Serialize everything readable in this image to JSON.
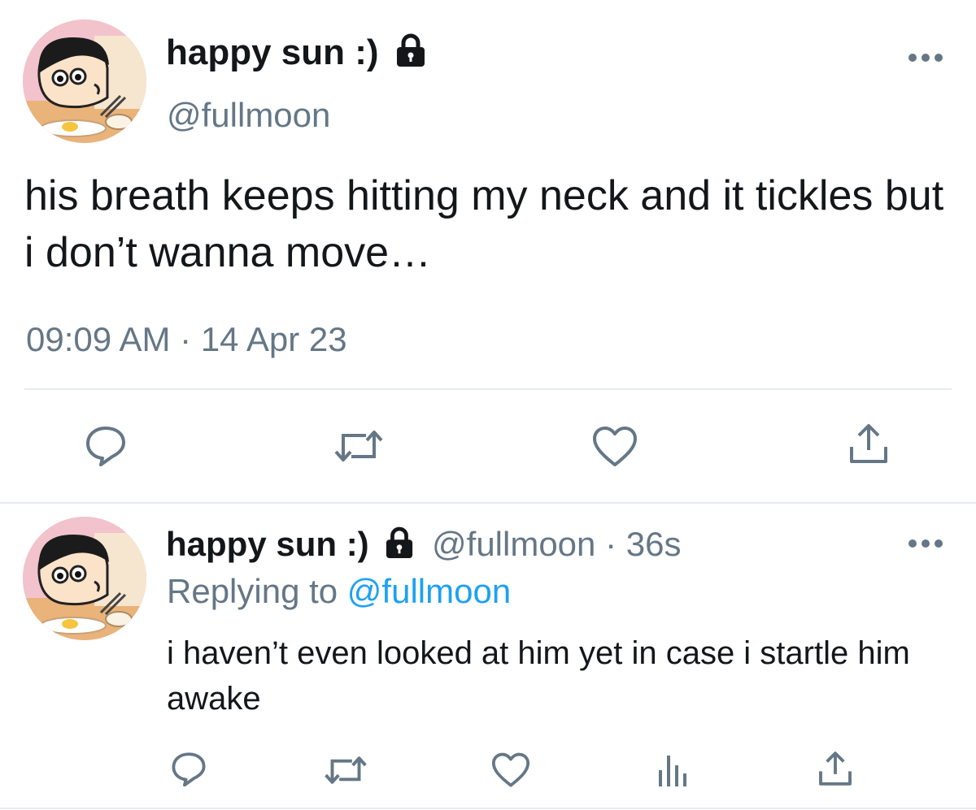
{
  "tweet": {
    "display_name": "happy sun :)",
    "handle": "@fullmoon",
    "text": "his breath keeps hitting my neck and it tickles but i don’t wanna move…",
    "time": "09:09 AM",
    "separator": "·",
    "date": "14 Apr 23",
    "actions": [
      "reply-icon",
      "retweet-icon",
      "like-icon",
      "share-icon"
    ]
  },
  "reply": {
    "display_name": "happy sun :)",
    "handle": "@fullmoon",
    "separator": "·",
    "age": "36s",
    "replying_prefix": "Replying to",
    "replying_handle": "@fullmoon",
    "text": "i haven’t even looked at him yet in case i startle him awake",
    "actions": [
      "reply-icon",
      "retweet-icon",
      "like-icon",
      "analytics-icon",
      "share-icon"
    ]
  },
  "colors": {
    "text": "#14171a",
    "secondary": "#657786",
    "link": "#1da1f2",
    "divider": "#e6ecf0"
  }
}
